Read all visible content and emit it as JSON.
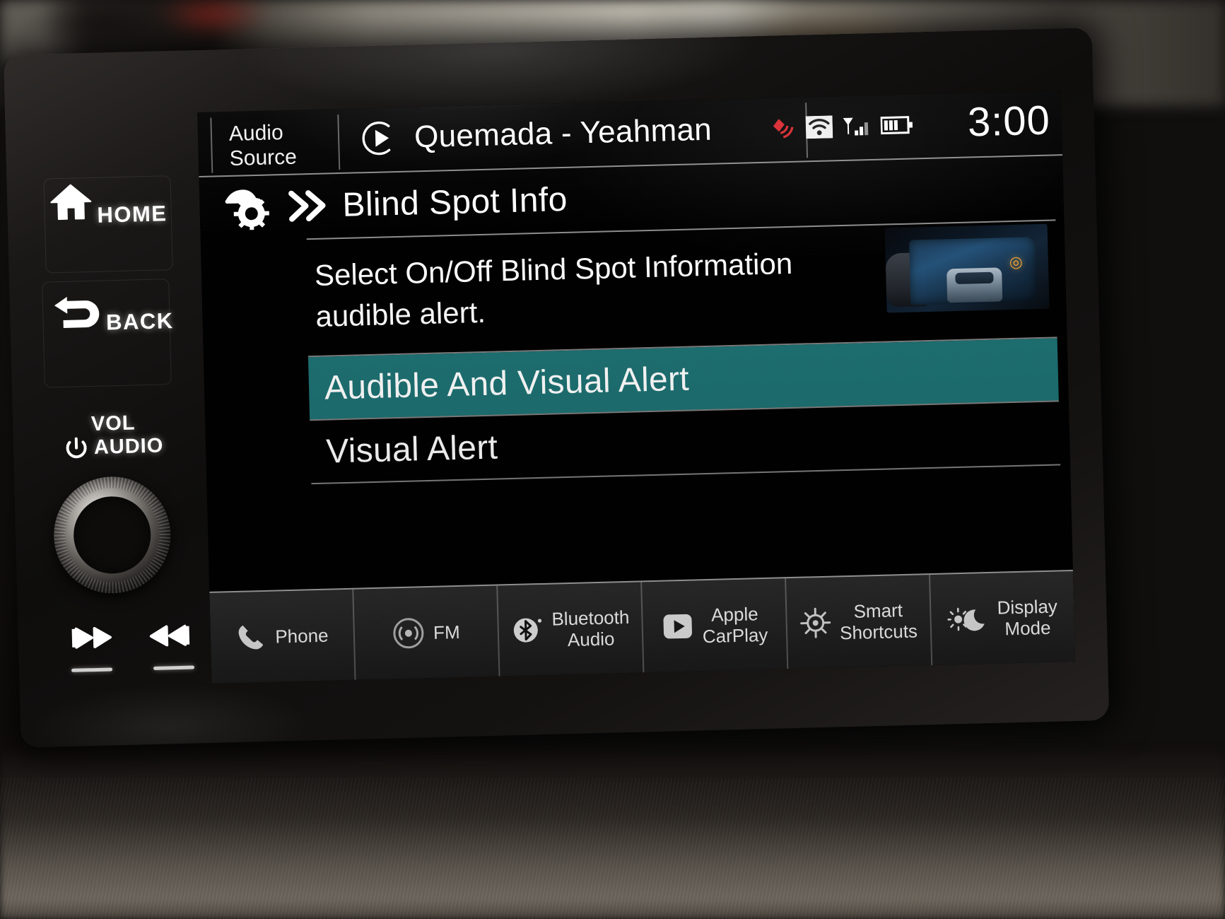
{
  "device": {
    "kind": "car-infotainment-touchscreen",
    "accent_teal": "#1d7173",
    "screen_bg": "#000000",
    "text_color": "#ffffff"
  },
  "hard_keys": {
    "home": {
      "label": "HOME",
      "icon": "home-icon"
    },
    "back": {
      "label": "BACK",
      "icon": "back-arrow-icon"
    },
    "volume": {
      "line1": "VOL",
      "line2": "AUDIO",
      "icon": "power-icon"
    },
    "prev_track": "prev-track-icon",
    "next_track": "next-track-icon"
  },
  "status_bar": {
    "audio_source_line1": "Audio",
    "audio_source_line2": "Source",
    "play_icon": "play-circle-icon",
    "track_title": "Quemada - Yeahman",
    "clock": "3:00",
    "icons": [
      {
        "name": "satellite-radio-icon",
        "color": "#d8232a"
      },
      {
        "name": "wifi-icon",
        "color": "#ffffff"
      },
      {
        "name": "cellular-signal-icon",
        "color": "#ffffff"
      },
      {
        "name": "battery-icon",
        "color": "#ffffff"
      }
    ]
  },
  "breadcrumb": {
    "settings_icon": "vehicle-settings-gear-icon",
    "chevron": "»",
    "title": "Blind Spot Info"
  },
  "content": {
    "description": "Select On/Off Blind Spot Information audible alert.",
    "illustration": "side-mirror-blind-spot-illustration"
  },
  "options": [
    {
      "label": "Audible And Visual Alert",
      "selected": true
    },
    {
      "label": "Visual Alert",
      "selected": false
    }
  ],
  "toolbar": [
    {
      "label": "Phone",
      "icon": "phone-handset-icon",
      "multiline": false
    },
    {
      "label": "FM",
      "icon": "radio-broadcast-icon",
      "multiline": false
    },
    {
      "label": "Bluetooth\nAudio",
      "icon": "bluetooth-icon",
      "multiline": true
    },
    {
      "label": "Apple\nCarPlay",
      "icon": "carplay-icon",
      "multiline": true
    },
    {
      "label": "Smart\nShortcuts",
      "icon": "smart-shortcuts-icon",
      "multiline": true
    },
    {
      "label": "Display\nMode",
      "icon": "brightness-day-night-icon",
      "multiline": true
    }
  ]
}
